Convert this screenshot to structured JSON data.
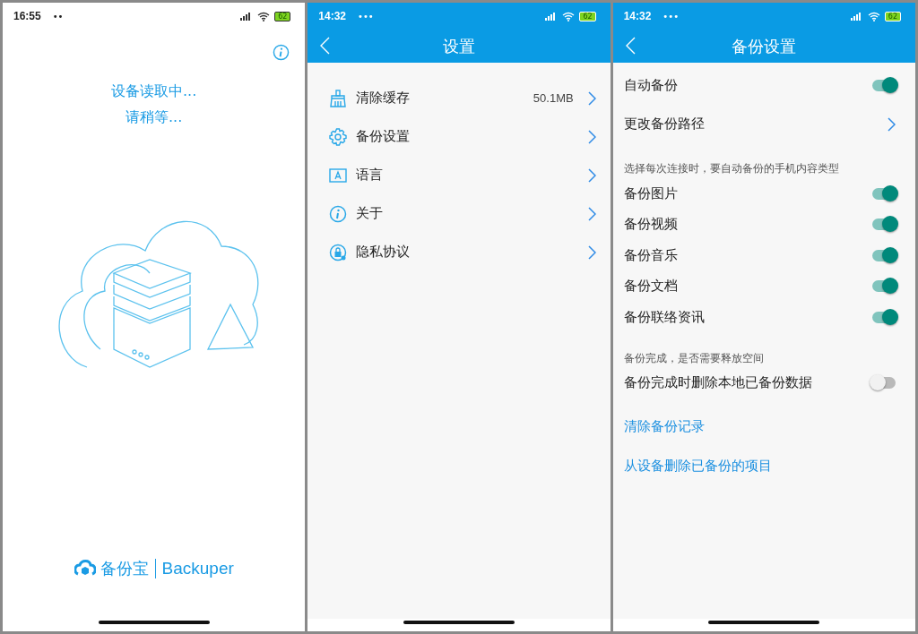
{
  "loading_screen": {
    "status_bar": {
      "time": "16:55",
      "dots": "••",
      "battery": "62"
    },
    "messages": [
      "设备读取中...",
      "请稍等..."
    ],
    "logo": {
      "name": "备份宝",
      "english": "Backuper"
    }
  },
  "settings_screen": {
    "status_bar": {
      "time": "14:32",
      "dots": "•••",
      "battery": "62"
    },
    "title": "设置",
    "items": [
      {
        "kind": "brush",
        "label": "清除缓存",
        "value": "50.1MB"
      },
      {
        "kind": "gear",
        "label": "备份设置"
      },
      {
        "kind": "language",
        "label": "语言"
      },
      {
        "kind": "info",
        "label": "关于"
      },
      {
        "kind": "privacy",
        "label": "隐私协议"
      }
    ]
  },
  "backup_settings_screen": {
    "status_bar": {
      "time": "14:32",
      "dots": "•••",
      "battery": "62"
    },
    "title": "备份设置",
    "rows": [
      {
        "kind": "toggle",
        "label": "自动备份",
        "on": true
      },
      {
        "kind": "link",
        "label": "更改备份路径"
      },
      {
        "kind": "header",
        "label": "选择每次连接时，要自动备份的手机内容类型"
      },
      {
        "kind": "toggle",
        "label": "备份图片",
        "on": true
      },
      {
        "kind": "toggle",
        "label": "备份视频",
        "on": true
      },
      {
        "kind": "toggle",
        "label": "备份音乐",
        "on": true
      },
      {
        "kind": "toggle",
        "label": "备份文档",
        "on": true
      },
      {
        "kind": "toggle",
        "label": "备份联络资讯",
        "on": true
      },
      {
        "kind": "header",
        "label": "备份完成，是否需要释放空间"
      },
      {
        "kind": "toggle",
        "label": "备份完成时删除本地已备份数据",
        "on": false
      },
      {
        "kind": "action",
        "label": "清除备份记录"
      },
      {
        "kind": "action",
        "label": "从设备删除已备份的项目"
      }
    ]
  }
}
